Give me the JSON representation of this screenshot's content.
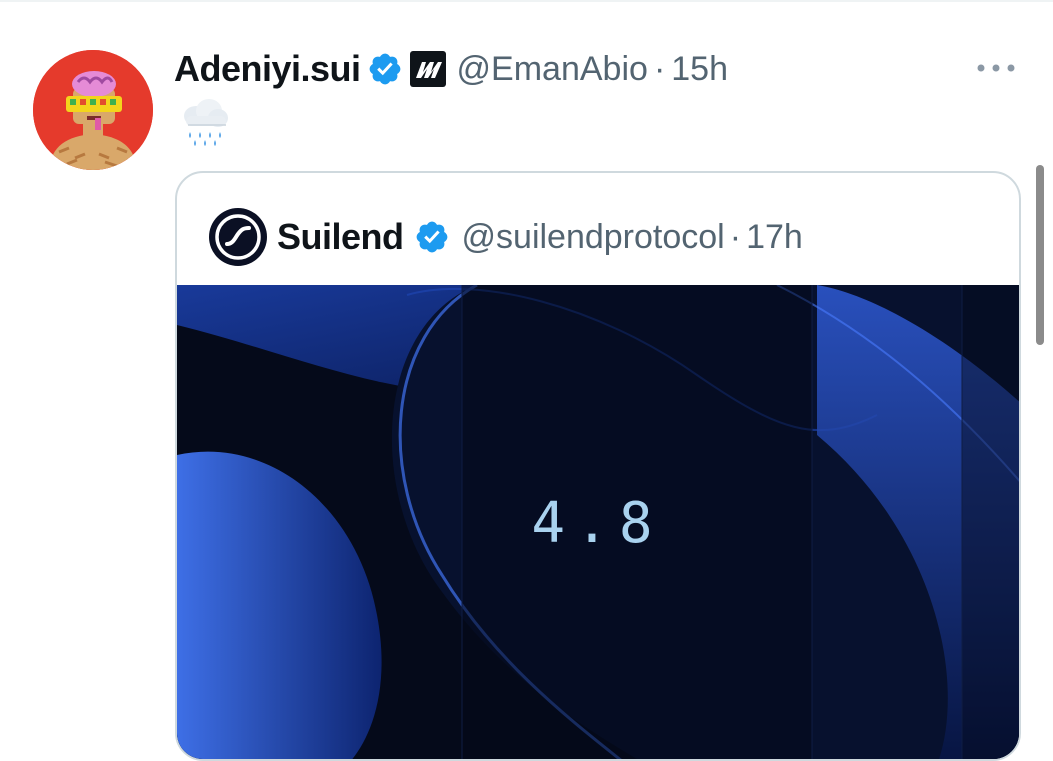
{
  "tweet": {
    "author": {
      "display_name": "Adeniyi.sui",
      "handle": "@EmanAbio",
      "verified": true,
      "affiliate_badge": "m-logo-icon"
    },
    "separator": "·",
    "time": "15h",
    "text_icon": "rain-cloud-icon",
    "more_icon": "more-horizontal-icon",
    "quoted": {
      "display_name": "Suilend",
      "handle": "@suilendprotocol",
      "verified": true,
      "separator": "·",
      "time": "17h",
      "media": {
        "value_text": "4.8"
      }
    }
  },
  "colors": {
    "verified_blue": "#1d9bf0",
    "secondary_text": "#536471",
    "avatar_bg": "#e53a2c",
    "media_bg": "#050a1a"
  }
}
